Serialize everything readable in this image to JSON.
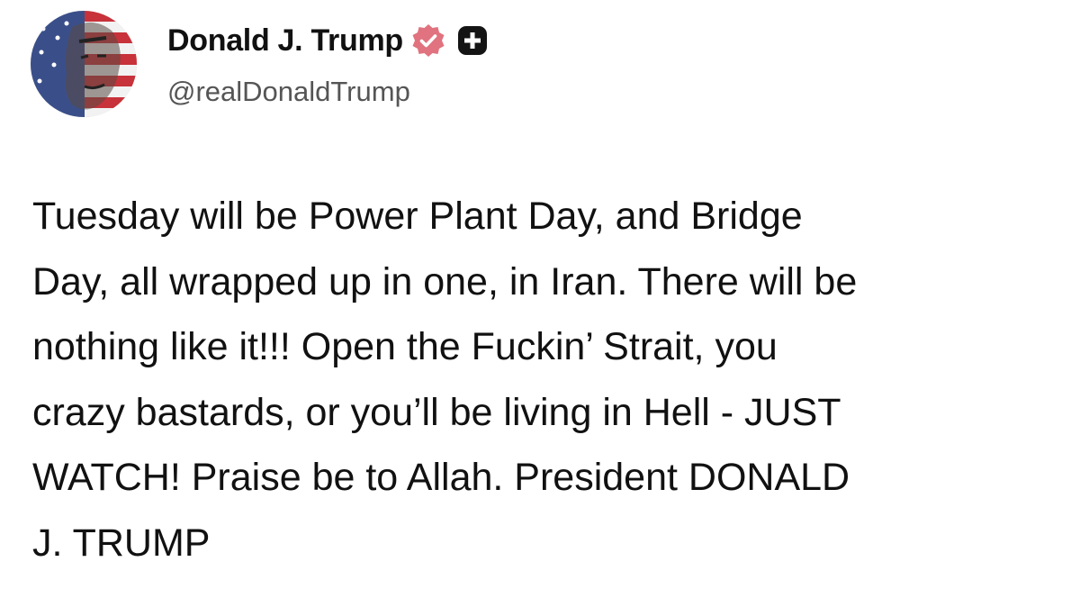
{
  "post": {
    "author": {
      "display_name": "Donald J. Trump",
      "handle": "@realDonaldTrump",
      "verified_badge_icon": "verified-check-badge",
      "affiliation_icon": "square-plus-badge",
      "badge_color": "#e0737f"
    },
    "text_lines": [
      "Tuesday will be Power Plant Day, and Bridge",
      "Day, all wrapped up in one, in Iran. There will be",
      "nothing like it!!! Open the Fuckin’ Strait, you",
      "crazy bastards, or you’ll be living in Hell - JUST",
      "WATCH! Praise be to Allah. President DONALD",
      "J. TRUMP"
    ]
  }
}
